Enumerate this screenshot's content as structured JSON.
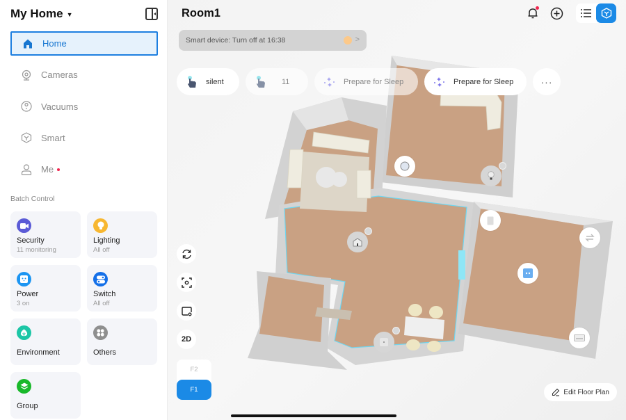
{
  "sidebar": {
    "home_title": "My Home",
    "nav": [
      {
        "label": "Home",
        "icon": "home-icon",
        "active": true
      },
      {
        "label": "Cameras",
        "icon": "camera-icon"
      },
      {
        "label": "Vacuums",
        "icon": "vacuum-icon"
      },
      {
        "label": "Smart",
        "icon": "cube-icon"
      },
      {
        "label": "Me",
        "icon": "person-icon",
        "badge": true
      }
    ],
    "batch_label": "Batch Control",
    "tiles": [
      {
        "name": "Security",
        "sub": "11 monitoring",
        "icon": "video-camera-icon",
        "color": "#5b5bd6"
      },
      {
        "name": "Lighting",
        "sub": "All off",
        "icon": "bulb-icon",
        "color": "#f7b731"
      },
      {
        "name": "Power",
        "sub": "3 on",
        "icon": "socket-icon",
        "color": "#1c95f2"
      },
      {
        "name": "Switch",
        "sub": "All off",
        "icon": "switch-icon",
        "color": "#1570e8"
      },
      {
        "name": "Environment",
        "sub": "",
        "icon": "leaf-icon",
        "color": "#1cc6a6"
      },
      {
        "name": "Others",
        "sub": "",
        "icon": "grid-icon",
        "color": "#8f8f8f"
      },
      {
        "name": "Group",
        "sub": "",
        "icon": "layers-icon",
        "color": "#19b82a"
      }
    ]
  },
  "main": {
    "room_title": "Room1",
    "notice": "Smart device: Turn off at 16:38",
    "scenes": [
      {
        "label": "silent",
        "icon": "tap-hand-icon",
        "style": "solid"
      },
      {
        "label": "11",
        "icon": "tap-hand-icon",
        "style": "faded"
      },
      {
        "label": "Prepare for Sleep",
        "icon": "sparkle-icon",
        "style": "faded"
      },
      {
        "label": "Prepare for Sleep",
        "icon": "sparkle-icon",
        "style": "solid"
      }
    ],
    "more_label": "···",
    "tools": {
      "rotate": "rotate-icon",
      "focus": "focus-icon",
      "device": "device-settings-icon",
      "view_2d": "2D"
    },
    "floors": [
      "F2",
      "F1"
    ],
    "active_floor": "F1",
    "edit_label": "Edit Floor Plan"
  },
  "colors": {
    "accent": "#1b8ae6",
    "active_border": "#1d7fe0",
    "notification": "#f0264f",
    "floor_wood": "#c9a183",
    "wall": "#d2d2d2",
    "room_outline": "#6fd6f0"
  }
}
